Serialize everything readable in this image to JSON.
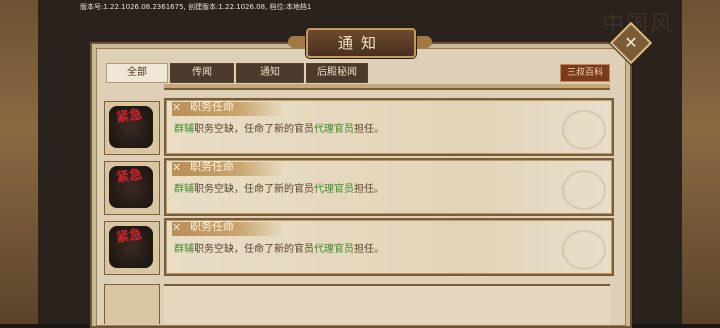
{
  "version_bar": "版本号:1.22.1026.08.2361675, 创建版本:1.22.1026.08, 档位:本地档1",
  "background_glyphs": "中国风",
  "dialog": {
    "title": "通知",
    "close_icon": "close-icon"
  },
  "tabs": [
    {
      "label": "全部",
      "active": true
    },
    {
      "label": "传闻",
      "active": false
    },
    {
      "label": "通知",
      "active": false
    },
    {
      "label": "后殿秘闻",
      "active": false
    }
  ],
  "wiki_button": "三叔百科",
  "notifications": [
    {
      "badge": "紧急",
      "title": "职务任命",
      "msg_part1": "群辅",
      "msg_part2": "职务空缺，任命了新的官员",
      "msg_part3": "代理官员",
      "msg_part4": "担任。"
    },
    {
      "badge": "紧急",
      "title": "职务任命",
      "msg_part1": "群辅",
      "msg_part2": "职务空缺，任命了新的官员",
      "msg_part3": "代理官员",
      "msg_part4": "担任。"
    },
    {
      "badge": "紧急",
      "title": "职务任命",
      "msg_part1": "群辅",
      "msg_part2": "职务空缺，任命了新的官员",
      "msg_part3": "代理官员",
      "msg_part4": "担任。"
    }
  ],
  "colors": {
    "highlight_green": "#3f8c2a",
    "badge_red": "#c8242a",
    "title_gold": "#c9a46d"
  }
}
